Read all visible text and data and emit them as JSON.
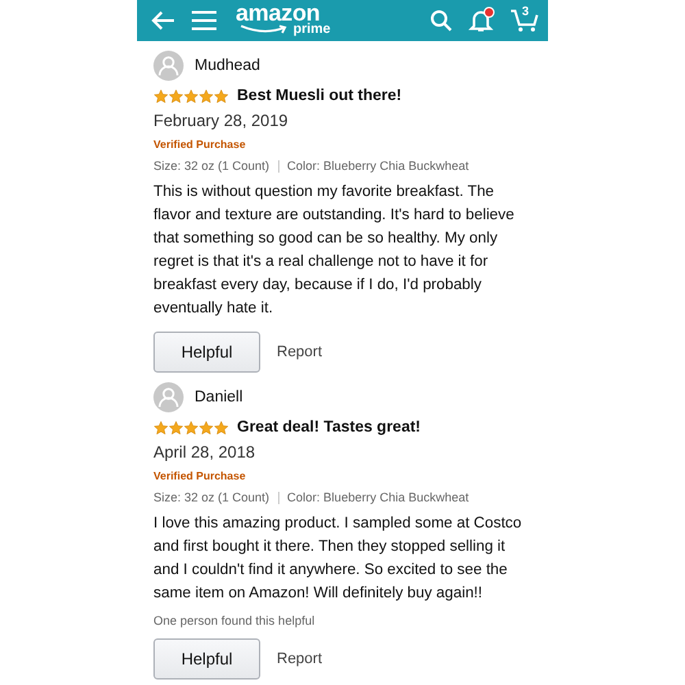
{
  "header": {
    "logo": "amazon",
    "logo_sub": "prime",
    "notification": true,
    "cart_count": "3"
  },
  "reviews": [
    {
      "author": "Mudhead",
      "stars": 5,
      "title": "Best Muesli out there!",
      "date": "February 28, 2019",
      "verified": "Verified Purchase",
      "size": "Size: 32 oz (1 Count)",
      "variant": "Color: Blueberry Chia Buckwheat",
      "body": "This is without question my favorite breakfast. The flavor and texture are outstanding. It's hard to believe that something so good can be so healthy. My only regret is that it's a real challenge not to have it for breakfast every day, because if I do, I'd probably eventually hate it.",
      "helpful_button": "Helpful",
      "report": "Report"
    },
    {
      "author": "Daniell",
      "stars": 5,
      "title": "Great deal! Tastes great!",
      "date": "April 28, 2018",
      "verified": "Verified Purchase",
      "size": "Size: 32 oz (1 Count)",
      "variant": "Color: Blueberry Chia Buckwheat",
      "body": "I love this amazing product. I sampled some at Costco and first bought it there. Then they stopped selling it and I couldn't find it anywhere. So excited to see the same item on Amazon! Will definitely buy again!!",
      "helpful_count": "One person found this helpful",
      "helpful_button": "Helpful",
      "report": "Report"
    }
  ]
}
